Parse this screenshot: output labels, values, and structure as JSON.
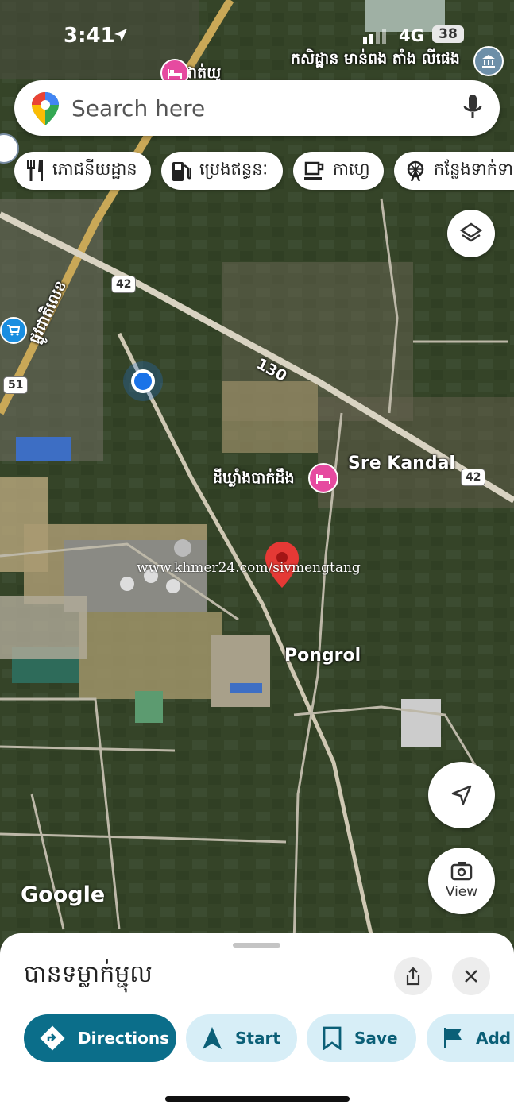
{
  "status_bar": {
    "time": "3:41",
    "network": "4G",
    "battery": "38"
  },
  "search": {
    "placeholder": "Search here"
  },
  "chips": [
    {
      "label": "ភោជនីយដ្ឋាន",
      "icon": "restaurant-icon"
    },
    {
      "label": "ប្រេងឥន្ធនៈ",
      "icon": "gas-station-icon"
    },
    {
      "label": "កាហ្វេ",
      "icon": "coffee-icon"
    },
    {
      "label": "កន្លែងទាក់ទាញ",
      "icon": "attraction-icon"
    }
  ],
  "map": {
    "top_poi_label": "ផាត់យូ",
    "top_right_label": "កសិដ្ឋាន មាន់ពង តាំង លីផេង",
    "road_130": "130",
    "road_42_top": "42",
    "road_42_right": "42",
    "road_51": "51",
    "vertical_road_label": "ផ្លូវជាតិលេខ",
    "sre_kandal": "Sre Kandal",
    "hotel_label": "ដីឃ្លាំងបាក់ដឹង",
    "pongrol": "Pongrol",
    "watermark": "www.khmer24.com/sivmengtang",
    "google": "Google",
    "view_label": "View"
  },
  "sheet": {
    "title": "បានទម្លាក់ម្ជុល",
    "actions": [
      {
        "label": "Directions",
        "icon": "directions-icon"
      },
      {
        "label": "Start",
        "icon": "navigation-arrow-icon"
      },
      {
        "label": "Save",
        "icon": "bookmark-icon"
      },
      {
        "label": "Add",
        "icon": "flag-icon"
      }
    ]
  }
}
